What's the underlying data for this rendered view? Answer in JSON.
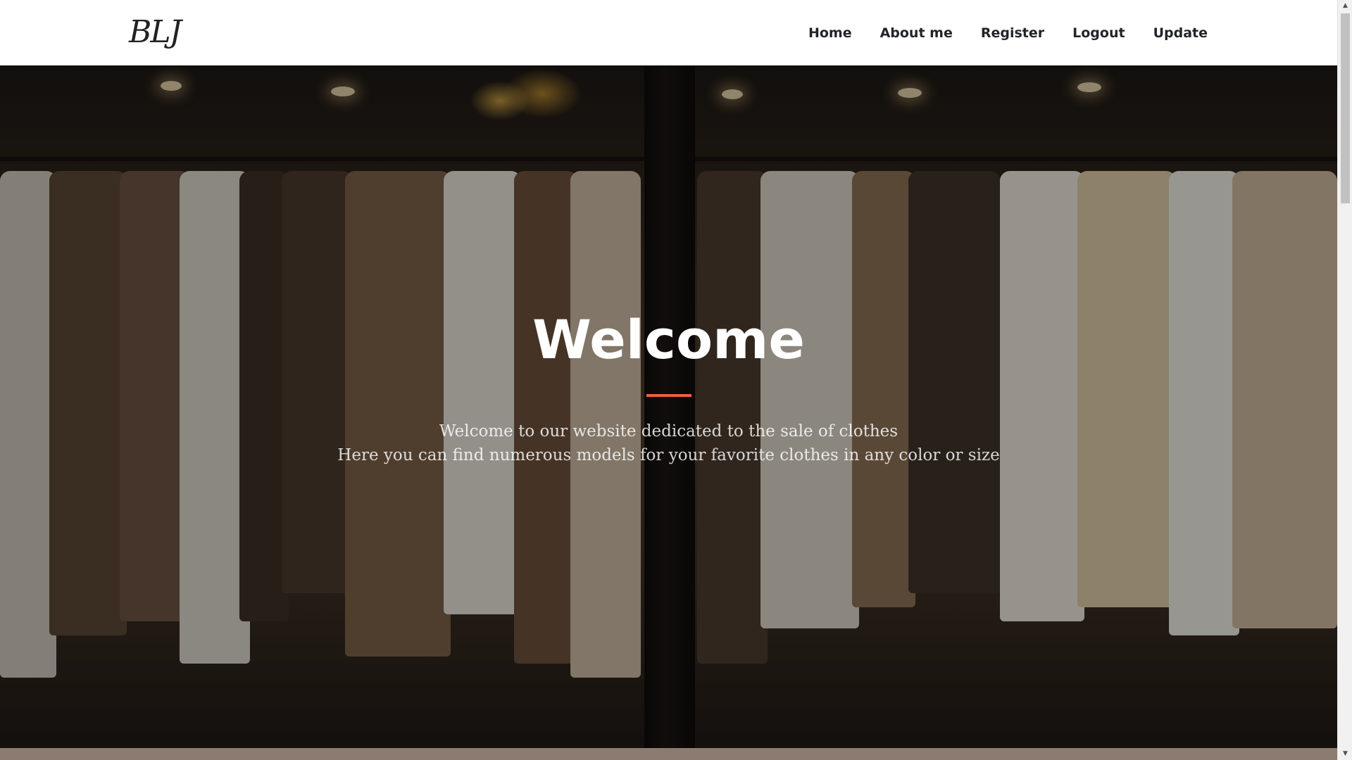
{
  "navbar": {
    "brand": "BLJ",
    "links": [
      "Home",
      "About me",
      "Register",
      "Logout",
      "Update"
    ]
  },
  "hero": {
    "title": "Welcome",
    "line1": "Welcome to our website dedicated to the sale of clothes",
    "line2": "Here you can find numerous models for your favorite clothes in any color or size",
    "accent_color": "#f05f40"
  },
  "scrollbar": {
    "up_icon": "triangle-up-icon",
    "down_icon": "triangle-down-icon"
  }
}
